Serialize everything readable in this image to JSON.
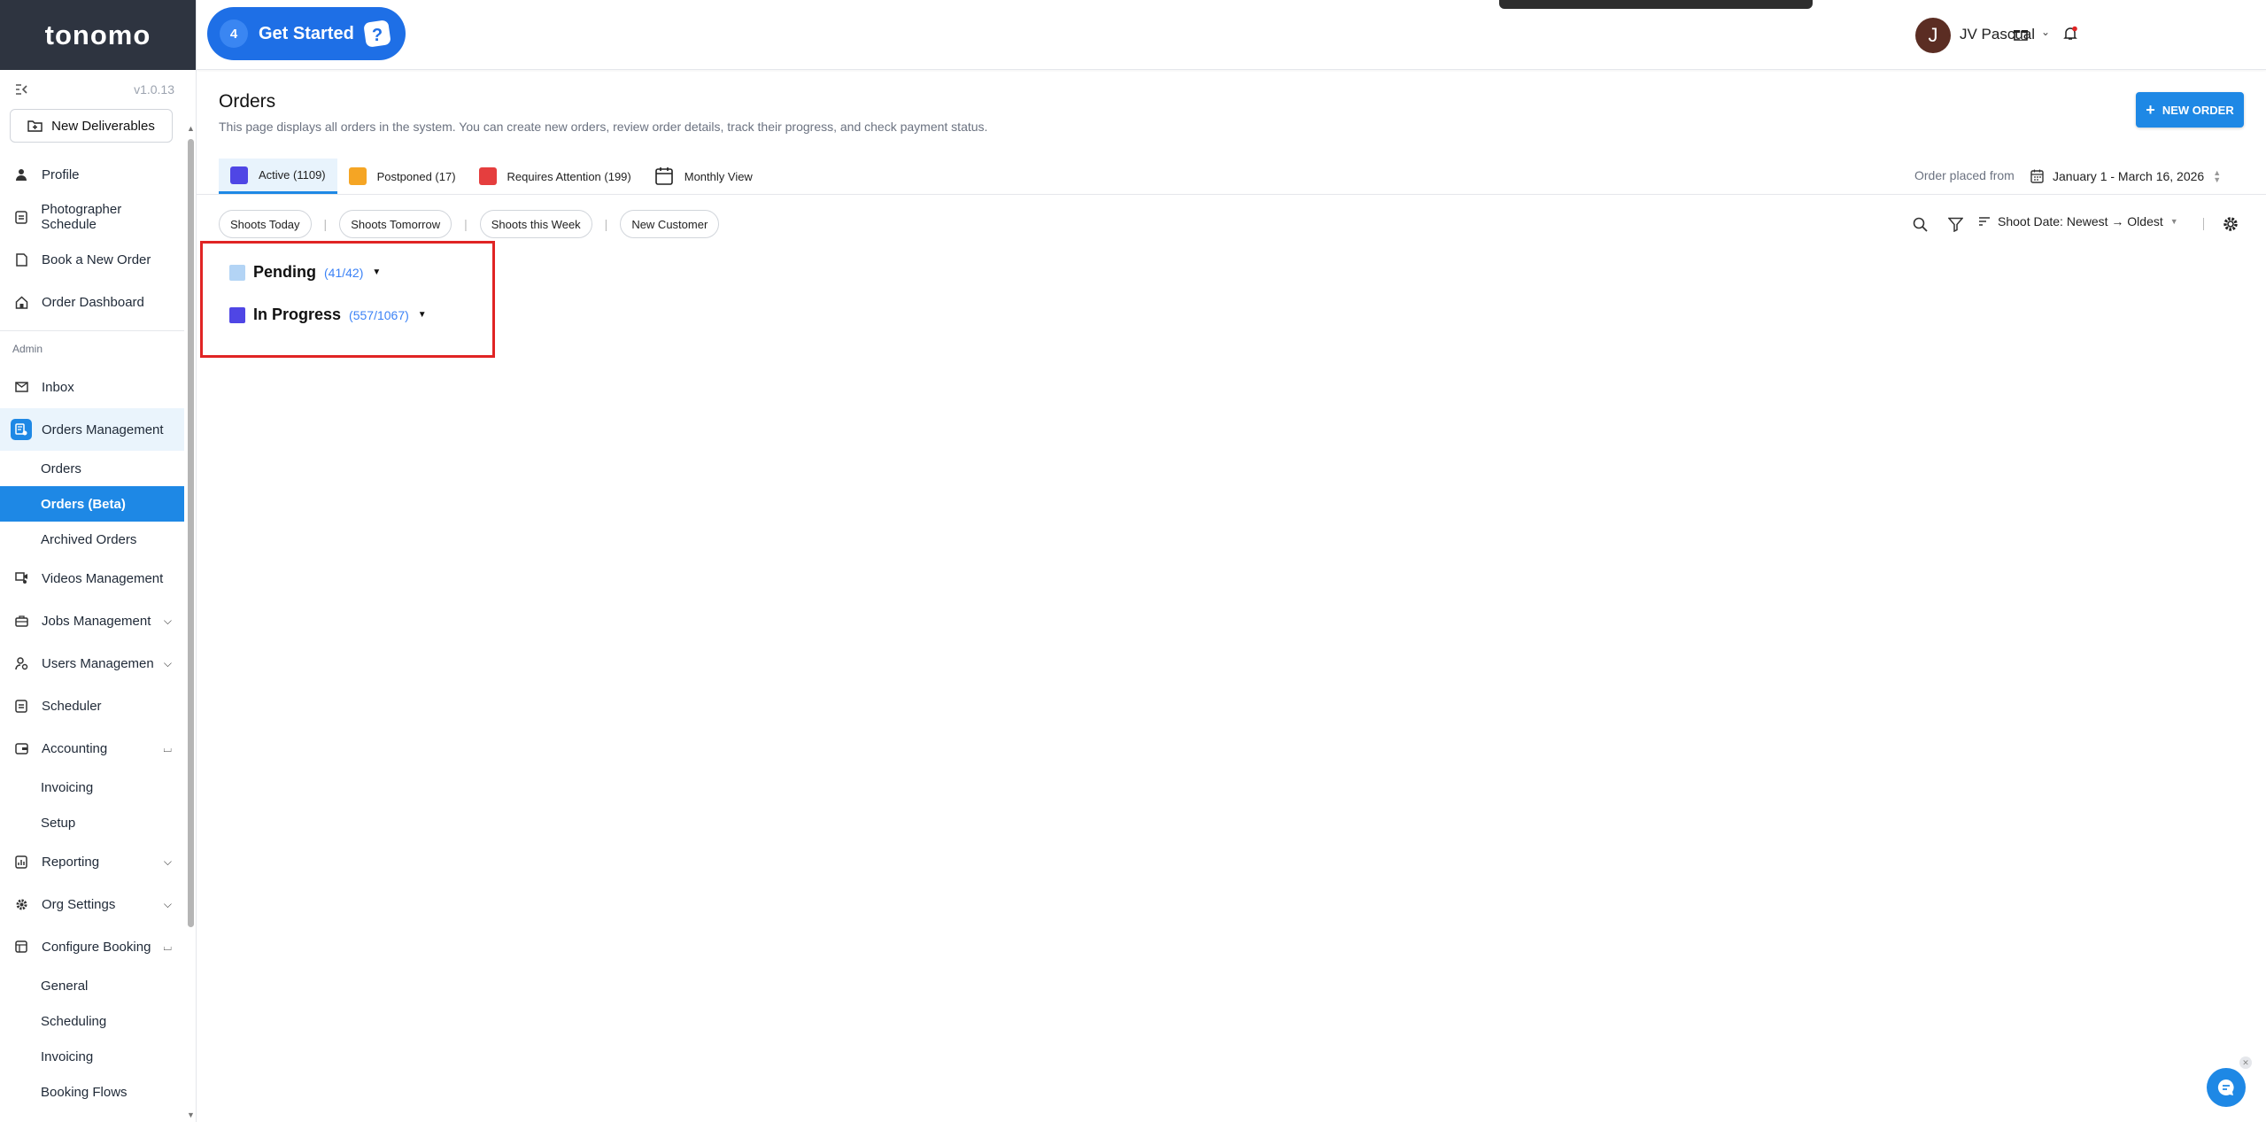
{
  "app": {
    "logo": "tonomo",
    "version": "v1.0.13"
  },
  "header": {
    "get_started": {
      "count": "4",
      "label": "Get Started"
    },
    "user": {
      "initial": "J",
      "name": "JV Pascual"
    }
  },
  "sidebar": {
    "new_deliverables": "New Deliverables",
    "items_top": [
      {
        "label": "Profile"
      },
      {
        "label": "Photographer Schedule"
      },
      {
        "label": "Book a New Order"
      },
      {
        "label": "Order Dashboard"
      }
    ],
    "section_admin": "Admin",
    "inbox": "Inbox",
    "orders_management": "Orders Management",
    "orders_sub": [
      "Orders",
      "Orders (Beta)",
      "Archived Orders"
    ],
    "videos_management": "Videos Management",
    "jobs_management": "Jobs Management",
    "users_management": "Users Managemen",
    "scheduler": "Scheduler",
    "accounting": "Accounting",
    "accounting_sub": [
      "Invoicing",
      "Setup"
    ],
    "reporting": "Reporting",
    "org_settings": "Org Settings",
    "configure_booking": "Configure Booking",
    "configure_sub": [
      "General",
      "Scheduling",
      "Invoicing",
      "Booking Flows"
    ]
  },
  "main": {
    "title": "Orders",
    "description": "This page displays all orders in the system. You can create new orders, review order details, track their progress, and check payment status.",
    "new_order": "NEW ORDER",
    "tabs": [
      {
        "label": "Active (1109)",
        "color": "#4f46e5"
      },
      {
        "label": "Postponed (17)",
        "color": "#f5a524"
      },
      {
        "label": "Requires Attention (199)",
        "color": "#e53e3e"
      },
      {
        "label": "Monthly View"
      }
    ],
    "date_filter": {
      "label": "Order placed from",
      "value": "January 1 - March 16, 2026"
    },
    "chips": [
      "Shoots Today",
      "Shoots Tomorrow",
      "Shoots this Week",
      "New Customer"
    ],
    "sort": "Shoot Date: Newest → Oldest",
    "groups": [
      {
        "name": "Pending",
        "count": "(41/42)",
        "color": "#b3d4f5"
      },
      {
        "name": "In Progress",
        "count": "(557/1067)",
        "color": "#4f46e5"
      }
    ]
  },
  "colors": {
    "primary": "#1e88e5",
    "highlight_box": "#e02424"
  }
}
